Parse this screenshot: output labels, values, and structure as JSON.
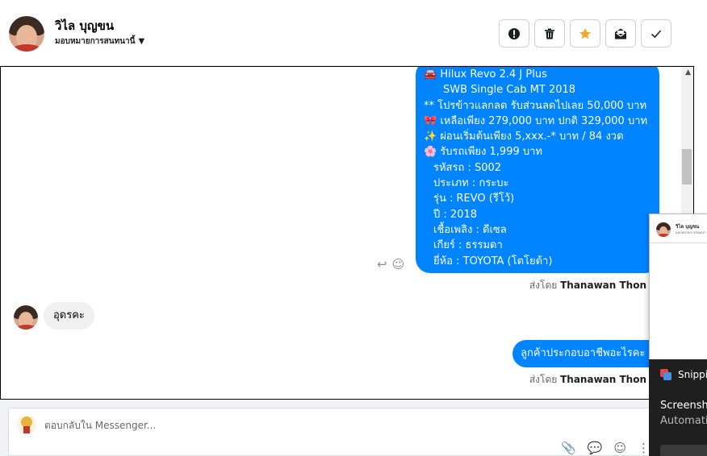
{
  "header": {
    "contact_name": "วิไล บุญขน",
    "assign_label": "มอบหมายการสนทนานี้",
    "actions": [
      {
        "name": "spam-button",
        "icon": "exclamation-icon",
        "glyph": "❗"
      },
      {
        "name": "delete-button",
        "icon": "trash-icon",
        "glyph": "🗑"
      },
      {
        "name": "star-button",
        "icon": "star-icon",
        "glyph": "★"
      },
      {
        "name": "unread-button",
        "icon": "envelope-icon",
        "glyph": "✉"
      },
      {
        "name": "done-button",
        "icon": "checkmark-icon",
        "glyph": "✓"
      }
    ]
  },
  "messages": {
    "card_lines": [
      {
        "text": "🚘 Hilux Revo 2.4 J Plus",
        "indent": 0
      },
      {
        "text": "SWB Single Cab MT 2018",
        "indent": 1
      },
      {
        "text": "** โปรข้าวแลกลด รับส่วนลดไปเลย 50,000 บาท",
        "indent": 0
      },
      {
        "text": "🎀 เหลือเพียง 279,000 บาท ปกติ 329,000 บาท",
        "indent": 0
      },
      {
        "text": "✨ ผ่อนเริ่มต้นเพียง 5,xxx.-* บาท / 84 งวด",
        "indent": 0
      },
      {
        "text": "🌸 รับรถเพียง 1,999 บาท",
        "indent": 0
      },
      {
        "text": "รหัสรถ : S002",
        "indent": 2
      },
      {
        "text": "ประเภท : กระบะ",
        "indent": 2
      },
      {
        "text": "รุ่น : REVO (รีโว้)",
        "indent": 2
      },
      {
        "text": "ปี : 2018",
        "indent": 2
      },
      {
        "text": "เชื้อเพลิง : ดีเซล",
        "indent": 2
      },
      {
        "text": "เกียร์ : ธรรมดา",
        "indent": 2
      },
      {
        "text": "ยี่ห้อ : TOYOTA (โตโยต้า)",
        "indent": 2
      }
    ],
    "sent_by_prefix": "ส่งโดย",
    "sent_by_name": "Thanawan Thon",
    "incoming_text": "อุดรคะ",
    "outgoing_text": "ลูกค้าประกอบอาชีพอะไรคะ",
    "sent_by_prefix_2": "ส่งโดย",
    "sent_by_name_2": "Thanawan Thon"
  },
  "composer": {
    "placeholder": "ตอบกลับใน Messenger..."
  },
  "popup": {
    "name": "วิไล บุญขน",
    "sub": "มอบหมายการสนทนา"
  },
  "toast": {
    "app_name": "Snippi",
    "title": "Screensho",
    "subtitle": "Automati"
  },
  "colors": {
    "bubble_blue": "#0084ff",
    "bubble_gray": "#f0f0f0",
    "star": "#f5a623"
  }
}
